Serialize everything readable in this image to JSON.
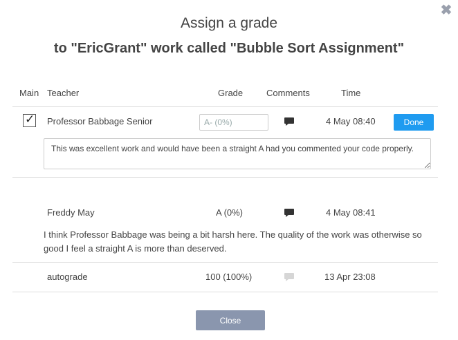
{
  "dialog": {
    "title": "Assign a grade",
    "subtitle": "to \"EricGrant\" work called \"Bubble Sort Assignment\"",
    "close_button_label": "Close"
  },
  "table": {
    "headers": {
      "main": "Main",
      "teacher": "Teacher",
      "grade": "Grade",
      "comments": "Comments",
      "time": "Time"
    },
    "rows": [
      {
        "main_checked": true,
        "teacher": "Professor Babbage Senior",
        "grade_placeholder": "A- (0%)",
        "time": "4 May 08:40",
        "action_label": "Done",
        "comment": "This was excellent work and would have been a straight A had you commented your code properly.",
        "comment_icon_color": "#333333"
      },
      {
        "teacher": "Freddy May",
        "grade": "A (0%)",
        "time": "4 May 08:41",
        "comment": "I think Professor Babbage was being a bit harsh here. The quality of the work was otherwise so good I feel a straight A is more than deserved.",
        "comment_icon_color": "#333333"
      },
      {
        "teacher": "autograde",
        "grade": "100 (100%)",
        "time": "13 Apr 23:08",
        "comment_icon_color": "#d6d6d6"
      }
    ]
  },
  "colors": {
    "done_button": "#1f9bf0",
    "close_button": "#8a96ae",
    "close_icon": "#9aa0ad"
  },
  "icons": {
    "dialog_close": "close-icon",
    "comment": "comment-bubble-icon",
    "check": "checkmark-icon"
  }
}
